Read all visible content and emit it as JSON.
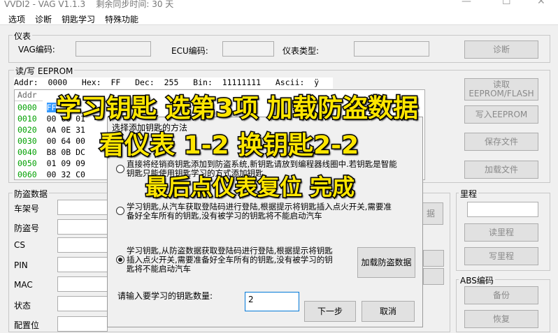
{
  "window": {
    "title": "VVDI2 - VAG V1.1.3    剩余同步时间: 30 天"
  },
  "menu": [
    "选项",
    "诊断",
    "钥匙学习",
    "特殊功能"
  ],
  "instrument": {
    "group_title": "仪表",
    "vag_label": "VAG编码:",
    "ecu_label": "ECU编码:",
    "type_label": "仪表类型:",
    "diag_button": "诊断"
  },
  "eeprom": {
    "group_title": "读/写 EEPROM",
    "header": "Addr:  0000   Hex:  FF   Dec:  255   Bin:  11111111   Ascii:  ÿ",
    "addr_col": "Addr",
    "rows": [
      {
        "addr": "0000",
        "data": "  "
      },
      {
        "addr": "0010",
        "data": "00 00 01"
      },
      {
        "addr": "0020",
        "data": "0A 0E 31"
      },
      {
        "addr": "0030",
        "data": "00 64 00"
      },
      {
        "addr": "0040",
        "data": "B8 0B DC"
      },
      {
        "addr": "0050",
        "data": "01 09 09"
      },
      {
        "addr": "0060",
        "data": "00 32 C0"
      }
    ],
    "read_button": "读取\nEEPROM/FLASH",
    "write_button": "写入EEPROM",
    "save_button": "保存文件",
    "load_button": "加载文件"
  },
  "immo": {
    "group_title": "防盗数据",
    "labels": [
      "车架号",
      "防盗号",
      "CS",
      "PIN",
      "MAC",
      "状态",
      "配置位"
    ]
  },
  "mileage": {
    "group_title": "里程",
    "read_button": "读里程",
    "write_button": "写里程"
  },
  "abs": {
    "group_title": "ABS编码",
    "backup_button": "备份",
    "restore_button": "恢复"
  },
  "hidden_buttons": {
    "partial_1": "据"
  },
  "dialog": {
    "title": "选择添加钥匙的方法",
    "option1": "直接将经销商钥匙添加到防盗系统,新钥匙请放到编程器线圈中.若钥匙是智能\n钥匙只能使用钥匙学习的方式添加钥匙",
    "option2": "学习钥匙,从汽车获取登陆码进行登陆,根据提示将钥匙插入点火开关,需要准\n备好全车所有的钥匙,没有被学习的钥匙将不能启动汽车",
    "option3": "学习钥匙,从防盗数据获取登陆码进行登陆,根据提示将钥匙\n插入点火开关,需要准备好全车所有的钥匙,没有被学习的钥\n匙将不能启动汽车",
    "load_immo_button": "加载防盗数据",
    "key_count_label": "请输入要学习的钥匙数量:",
    "key_count_value": "2",
    "next_button": "下一步",
    "cancel_button": "取消"
  },
  "captions": {
    "line1": "学习钥匙 选第3项 加载防盗数据",
    "line2": "看仪表 1-2  换钥匙2-2",
    "line3": "最后点仪表复位 完成"
  },
  "colors": {
    "caption": "#ffe600",
    "addr_green": "#00a000",
    "focus_blue": "#0078d7"
  }
}
